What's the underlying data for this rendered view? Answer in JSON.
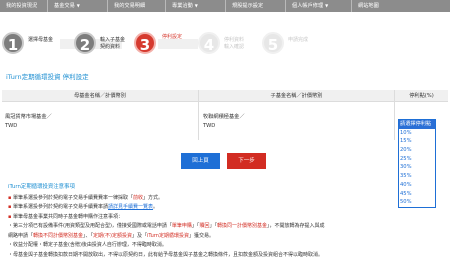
{
  "nav": [
    {
      "label": "我的投資現況",
      "caret": false
    },
    {
      "label": "基金交易",
      "caret": true
    },
    {
      "label": "我的交易明細",
      "caret": false
    },
    {
      "label": "專業洽動",
      "caret": true
    },
    {
      "label": "規股提示設定",
      "caret": false
    },
    {
      "label": "個人帳戶修理",
      "caret": true
    },
    {
      "label": "網站地圖",
      "caret": false
    }
  ],
  "steps": [
    {
      "num": "1",
      "line1": "選擇母基金",
      "line2": ""
    },
    {
      "num": "2",
      "line1": "輸入子基金",
      "line2": "契約資料"
    },
    {
      "num": "3",
      "line1": "停利設定",
      "line2": ""
    },
    {
      "num": "4",
      "line1": "停利資料",
      "line2": "輸入確認"
    },
    {
      "num": "5",
      "line1": "申請完成",
      "line2": ""
    }
  ],
  "heading": "iTurn定期循環投資 停利設定",
  "table": {
    "col_mother": "母基金名稱／計價幣別",
    "col_child": "子基金名稱／計價幣別",
    "col_ratio": "停利點(%)",
    "mother_fund": "風冠貨幣市場基金／",
    "mother_currency": "TWD",
    "child_fund": "牧聯網積極基金／",
    "child_currency": "TWD"
  },
  "ratio_options": [
    "請選擇停利點",
    "10%",
    "15%",
    "20%",
    "25%",
    "30%",
    "35%",
    "40%",
    "45%",
    "50%"
  ],
  "buttons": {
    "back": "回上頁",
    "next": "下一步"
  },
  "notes": {
    "title": "iTurn定期循環投資注意事項",
    "line1_a": "單筆系選投參列於契約電子交易手續費費率一律採取「",
    "line1_red": "前收",
    "line1_b": "」方式。",
    "line2_a": "單筆系選投參列於契約電子交易手續費率請",
    "line2_link": "請詳見手續費一覽表",
    "line2_b": "。",
    "line3": "單筆母基金事業共同時子基金轉申購作注意事項：",
    "line4_a": "・第三分項已有設備事件(用資類型及用配合型)，僅接受國際或電話申請「",
    "line4_red1": "單筆申購",
    "line4_b": "」「",
    "line4_red2": "贖回",
    "line4_c": "」「",
    "line4_red3": "轉換同一計價幣別基金",
    "line4_d": "」，不開放轉為存提入與成",
    "line5_a": "網路申請「",
    "line5_red1": "轉換不同計價幣別基金",
    "line5_b": "」、「",
    "line5_red2": "定期(不)定額投資",
    "line5_c": "」及「",
    "line5_red3": "iTurn定期循環投資",
    "line5_d": "」獲交易。",
    "line6": "・收益分配權・轉定子基金(含贈)後由投資人自行辦理，不得臨時取消。",
    "line7": "・母基金與子基金轉換扣款日期不開放取出，不得以原契約日，此有給予母基金與子基金之轉換條件，且扣款金額及投資組合不得以臨時取消。"
  }
}
